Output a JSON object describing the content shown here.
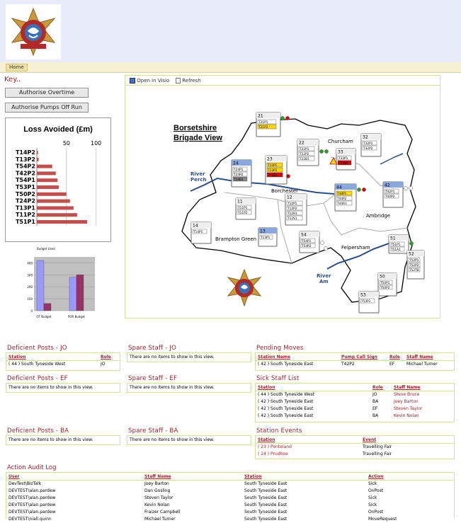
{
  "nav": {
    "home_tab": "Home"
  },
  "key_title": "Key..",
  "buttons": {
    "authorise_overtime": "Authorise Overtime",
    "authorise_pumps_off_run": "Authorise Pumps Off Run"
  },
  "loss_chart": {
    "chart_data": {
      "type": "bar",
      "title": "Loss Avoided (£m)",
      "categories": [
        "T14P2",
        "T13P2",
        "T54P2",
        "T42P2",
        "T54P1",
        "T53P1",
        "T50P2",
        "T24P2",
        "T13P1",
        "T11P2",
        "T51P1"
      ],
      "values": [
        2,
        3,
        26,
        32,
        35,
        37,
        50,
        56,
        62,
        68,
        85
      ],
      "xticks": [
        "50",
        "100"
      ],
      "xlim": [
        0,
        110
      ],
      "grid": true
    }
  },
  "budget_chart": {
    "chart_data": {
      "type": "bar",
      "categories": [
        "OT Budget",
        "POR Budget"
      ],
      "series": [
        {
          "name": "Budget",
          "values": [
            420,
            280
          ]
        },
        {
          "name": "Used",
          "values": [
            60,
            300
          ]
        }
      ],
      "legend": [
        "Budget",
        "Used"
      ],
      "yticks": [
        "400",
        "300",
        "200",
        "100",
        "0"
      ],
      "ylim": [
        0,
        450
      ],
      "colors": [
        "#9999ff",
        "#993366"
      ]
    }
  },
  "map": {
    "toolbar": {
      "open_visio": "Open in Visio",
      "refresh": "Refresh"
    },
    "title_line1": "Borsetshire",
    "title_line2": "Brigade View",
    "places": {
      "churcham": "Churcham",
      "borchester": "Borchester",
      "ambridge": "Ambridge",
      "brampton": "Brampton Green",
      "felpersham": "Felpersham",
      "river_perch_1": "River",
      "river_perch_2": "Perch",
      "river_am_1": "River",
      "river_am_2": "Am"
    },
    "stations": [
      {
        "id": "21",
        "items": [
          "T21P1",
          "T21P2"
        ]
      },
      {
        "id": "22",
        "items": [
          "T22P1",
          "T22P2",
          "T22B1"
        ]
      },
      {
        "id": "32",
        "items": [
          "T32P1",
          "T32P2"
        ]
      },
      {
        "id": "33",
        "items": [
          "T33P1",
          "T33B1"
        ]
      },
      {
        "id": "23",
        "items": [
          "T23P1",
          "T23P2",
          "T23B1"
        ]
      },
      {
        "id": "24",
        "items": [
          "T24P1",
          "T24P2",
          "T24B1"
        ]
      },
      {
        "id": "44",
        "items": [
          "T44P1",
          "T44P2",
          "T44R1"
        ]
      },
      {
        "id": "42",
        "items": [
          "T42P1",
          "T42P2"
        ]
      },
      {
        "id": "11",
        "items": [
          "T11P1",
          "T11P2"
        ]
      },
      {
        "id": "12",
        "items": [
          "T12P1",
          "T12P2",
          "T12R1",
          "T12S1"
        ]
      },
      {
        "id": "14",
        "items": [
          "T14P1"
        ]
      },
      {
        "id": "13",
        "items": [
          "T13P1"
        ]
      },
      {
        "id": "54",
        "items": [
          "T54P1",
          "T54P2"
        ]
      },
      {
        "id": "51",
        "items": [
          "T51P1",
          "T51A1"
        ]
      },
      {
        "id": "52",
        "items": [
          "T52P1",
          "T52P2",
          "T52TB"
        ]
      },
      {
        "id": "50",
        "items": [
          "T50P1",
          "T50P2"
        ]
      },
      {
        "id": "53",
        "items": [
          "T53P1"
        ]
      }
    ]
  },
  "deficient_jo": {
    "title": "Deficient Posts - JO",
    "headers": [
      "Station",
      "Role"
    ],
    "rows": [
      [
        "( 44 ) South Tyneside West",
        "JO"
      ]
    ]
  },
  "spare_jo": {
    "title": "Spare Staff - JO",
    "empty": "There are no items to show in this view."
  },
  "pending": {
    "title": "Pending Moves",
    "headers": [
      "Station Name",
      "Pump Call Sign",
      "Role",
      "Staff Name"
    ],
    "rows": [
      [
        "( 42 ) South Tyneside East",
        "T42P2",
        "EF",
        "Michael Turner"
      ]
    ]
  },
  "deficient_ef": {
    "title": "Deficient Posts - EF",
    "empty": "There are no items to show in this view."
  },
  "spare_ef": {
    "title": "Spare Staff - EF",
    "empty": "There are no items to show in this view."
  },
  "sick": {
    "title": "Sick Staff List",
    "headers": [
      "Station",
      "Role",
      "Staff Name"
    ],
    "rows": [
      [
        "( 44 ) South Tyneside West",
        "JO",
        "Steve Bruce"
      ],
      [
        "( 42 ) South Tyneside East",
        "BA",
        "Joey Barton"
      ],
      [
        "( 42 ) South Tyneside East",
        "EF",
        "Steven Taylor"
      ],
      [
        "( 42 ) South Tyneside East",
        "BA",
        "Kevin Nolan"
      ]
    ]
  },
  "deficient_ba": {
    "title": "Deficient Posts - BA",
    "empty": "There are no items to show in this view."
  },
  "spare_ba": {
    "title": "Spare Staff - BA",
    "empty": "There are no items to show in this view."
  },
  "events": {
    "title": "Station Events",
    "headers": [
      "Station",
      "Event"
    ],
    "rows": [
      [
        "( 23 ) Ponteland",
        "Travelling Fair"
      ],
      [
        "( 24 ) Prudhoe",
        "Travelling Fair"
      ]
    ]
  },
  "audit": {
    "title": "Action Audit Log",
    "headers": [
      "User",
      "Staff Name",
      "Station",
      "Action"
    ],
    "rows": [
      [
        "DevTest\\BizTalk",
        "Joey Barton",
        "South Tyneside East",
        "Sick"
      ],
      [
        "DEVTEST\\alan.pardew",
        "Dan Gosling",
        "South Tyneside East",
        "OnPost"
      ],
      [
        "DEVTEST\\alan.pardew",
        "Steven Taylor",
        "South Tyneside East",
        "Sick"
      ],
      [
        "DEVTEST\\alan.pardew",
        "Kevin Nolan",
        "South Tyneside East",
        "Sick"
      ],
      [
        "DEVTEST\\alan.pardew",
        "Fraizer Campbell",
        "South Tyneside East",
        "OnPost"
      ],
      [
        "DEVTEST\\niall.quinn",
        "Michael Turner",
        "South Tyneside East",
        "MoveRequest"
      ]
    ]
  }
}
